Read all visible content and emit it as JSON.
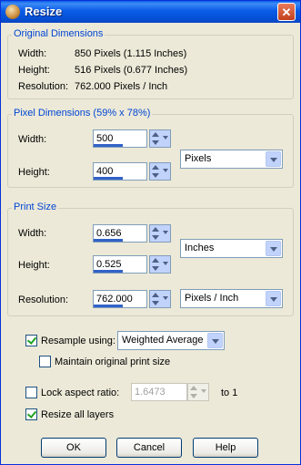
{
  "window": {
    "title": "Resize",
    "close": "✕"
  },
  "original": {
    "label": "Original Dimensions",
    "width_label": "Width:",
    "width_value": "850 Pixels (1.115 Inches)",
    "height_label": "Height:",
    "height_value": "516 Pixels (0.677 Inches)",
    "resolution_label": "Resolution:",
    "resolution_value": "762.000 Pixels / Inch"
  },
  "pixel": {
    "label": "Pixel Dimensions (59% x 78%)",
    "width_label": "Width:",
    "width_value": "500",
    "height_label": "Height:",
    "height_value": "400",
    "unit": "Pixels"
  },
  "print": {
    "label": "Print Size",
    "width_label": "Width:",
    "width_value": "0.656",
    "height_label": "Height:",
    "height_value": "0.525",
    "resolution_label": "Resolution:",
    "resolution_value": "762.000",
    "unit": "Inches",
    "res_unit": "Pixels / Inch"
  },
  "options": {
    "resample_label": "Resample using:",
    "resample_method": "Weighted Average",
    "maintain_label": "Maintain original print size",
    "lock_label": "Lock aspect ratio:",
    "lock_value": "1.6473",
    "to_label": "to 1",
    "resize_layers_label": "Resize all layers"
  },
  "buttons": {
    "ok": "OK",
    "cancel": "Cancel",
    "help": "Help"
  }
}
